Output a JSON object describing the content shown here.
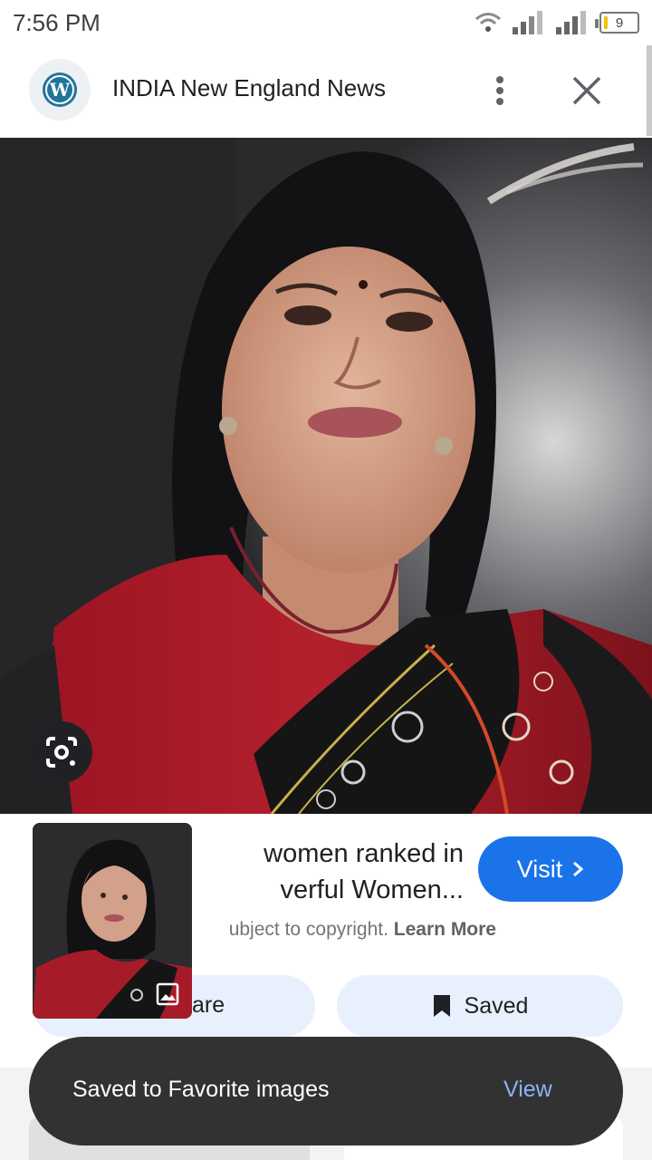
{
  "status_bar": {
    "time": "7:56 PM",
    "battery_level": "9",
    "icons": [
      "wifi-icon",
      "signal-icon",
      "signal-icon",
      "battery-icon"
    ]
  },
  "header": {
    "site_name": "INDIA New England News",
    "logo_icon": "wordpress-logo-icon",
    "more_icon": "more-vert-icon",
    "close_icon": "close-icon"
  },
  "image_viewer": {
    "lens_icon": "google-lens-icon"
  },
  "result": {
    "title_line1": " women ranked in",
    "title_line2": "verful Women...",
    "copyright_text": "ubject to copyright.",
    "learn_more": "Learn More",
    "visit_label": "Visit",
    "share_label": "are",
    "saved_label": "Saved",
    "accent_color": "#1a73e8"
  },
  "snackbar": {
    "message": "Saved to Favorite images",
    "action": "View"
  }
}
